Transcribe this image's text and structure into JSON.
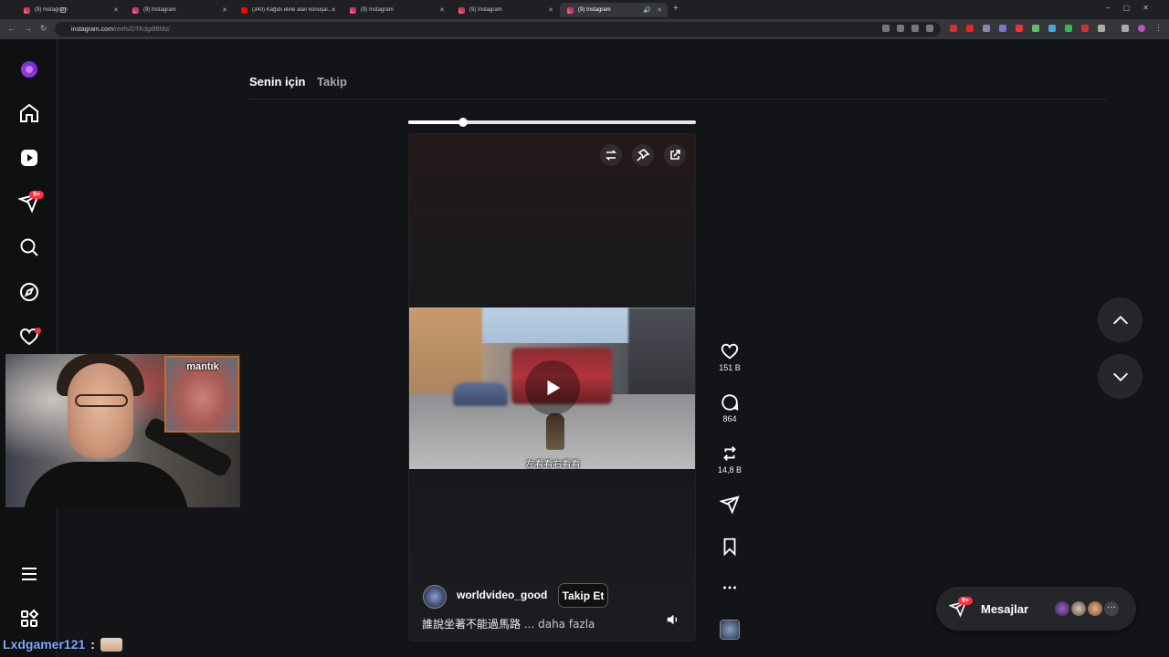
{
  "browser": {
    "tabs": [
      {
        "title": "(9) Instagram",
        "icon": "instagram-icon",
        "active": false
      },
      {
        "title": "(9) Instagram",
        "icon": "instagram-icon",
        "active": false
      },
      {
        "title": "(340) Kağıdı eline alan konuşal...",
        "icon": "youtube-icon",
        "active": false
      },
      {
        "title": "(9) Instagram",
        "icon": "instagram-icon",
        "active": false
      },
      {
        "title": "(9) Instagram",
        "icon": "instagram-icon",
        "active": false
      },
      {
        "title": "(9) Instagram",
        "icon": "instagram-icon",
        "active": true
      }
    ],
    "url_host": "instagram.com",
    "url_path": "/reels/DTKdgdlBMz/"
  },
  "sidebar": {
    "notif_badge": "9+"
  },
  "feed": {
    "tab_for_you": "Senin için",
    "tab_following": "Takip"
  },
  "reel": {
    "progress": 0.19,
    "subtitle": "左看看右看看",
    "username": "worldvideo_good",
    "follow_label": "Takip Et",
    "caption": "誰說坐著不能過馬路",
    "caption_more": "... daha fazla"
  },
  "actions": {
    "likes": "151 B",
    "comments": "864",
    "reposts": "14,8 B"
  },
  "messages": {
    "label": "Mesajlar",
    "badge": "9+"
  },
  "webcam": {
    "inset_text": "mantık",
    "chat_user": "Lxdgamer121",
    "chat_sep": ":"
  },
  "colors": {
    "accent_red": "#ff3040",
    "background": "#131417",
    "chat_name": "#7fa8ff"
  }
}
